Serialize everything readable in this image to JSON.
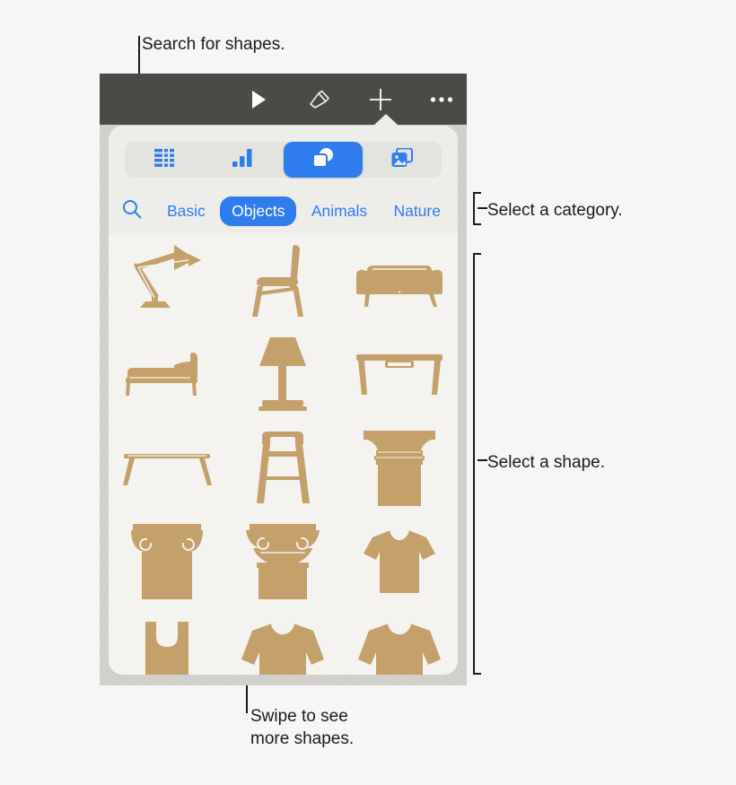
{
  "annotations": [
    {
      "id": "search",
      "text": "Search for shapes."
    },
    {
      "id": "category",
      "text": "Select a category."
    },
    {
      "id": "shape",
      "text": "Select a shape."
    },
    {
      "id": "swipe",
      "text": "Swipe to see\nmore shapes."
    }
  ],
  "toolbar": {
    "icons": [
      {
        "name": "play-icon",
        "label": "Play"
      },
      {
        "name": "format-brush-icon",
        "label": "Format"
      },
      {
        "name": "add-icon",
        "label": "Insert"
      },
      {
        "name": "more-options-icon",
        "label": "More"
      }
    ]
  },
  "insert_popover": {
    "tabs": [
      {
        "name": "tab-table",
        "icon": "table-icon",
        "label": "Table",
        "selected": false
      },
      {
        "name": "tab-chart",
        "icon": "chart-icon",
        "label": "Chart",
        "selected": false
      },
      {
        "name": "tab-shapes",
        "icon": "shapes-icon",
        "label": "Shapes",
        "selected": true
      },
      {
        "name": "tab-media",
        "icon": "media-icon",
        "label": "Media",
        "selected": false
      }
    ],
    "search": {
      "icon": "search-icon",
      "label": "Search"
    },
    "categories": [
      {
        "label": "Basic",
        "selected": false
      },
      {
        "label": "Objects",
        "selected": true
      },
      {
        "label": "Animals",
        "selected": false
      },
      {
        "label": "Nature",
        "selected": false
      }
    ],
    "shapes": [
      {
        "name": "shape-desk-lamp",
        "label": "Desk lamp"
      },
      {
        "name": "shape-chair",
        "label": "Chair"
      },
      {
        "name": "shape-sofa",
        "label": "Sofa"
      },
      {
        "name": "shape-bed",
        "label": "Bed"
      },
      {
        "name": "shape-table-lamp",
        "label": "Table lamp"
      },
      {
        "name": "shape-desk",
        "label": "Desk"
      },
      {
        "name": "shape-coffee-table",
        "label": "Coffee table"
      },
      {
        "name": "shape-bar-stool",
        "label": "Bar stool"
      },
      {
        "name": "shape-doric-column",
        "label": "Doric column"
      },
      {
        "name": "shape-ionic-column",
        "label": "Ionic column"
      },
      {
        "name": "shape-corinthian-column",
        "label": "Corinthian column"
      },
      {
        "name": "shape-t-shirt",
        "label": "T-shirt"
      },
      {
        "name": "shape-tank-top",
        "label": "Tank top"
      },
      {
        "name": "shape-sweater",
        "label": "Sweater"
      },
      {
        "name": "shape-sweatshirt",
        "label": "Sweatshirt"
      }
    ]
  },
  "colors": {
    "accent": "#2f7ced",
    "toolbar_bg": "#4a4a47",
    "popover_bg": "#ededea",
    "grid_bg": "#f4f3ef",
    "shape_fill": "#c4a06a",
    "canvas_bg": "#d3d2cd",
    "annotation_text": "#1b1b1b"
  }
}
